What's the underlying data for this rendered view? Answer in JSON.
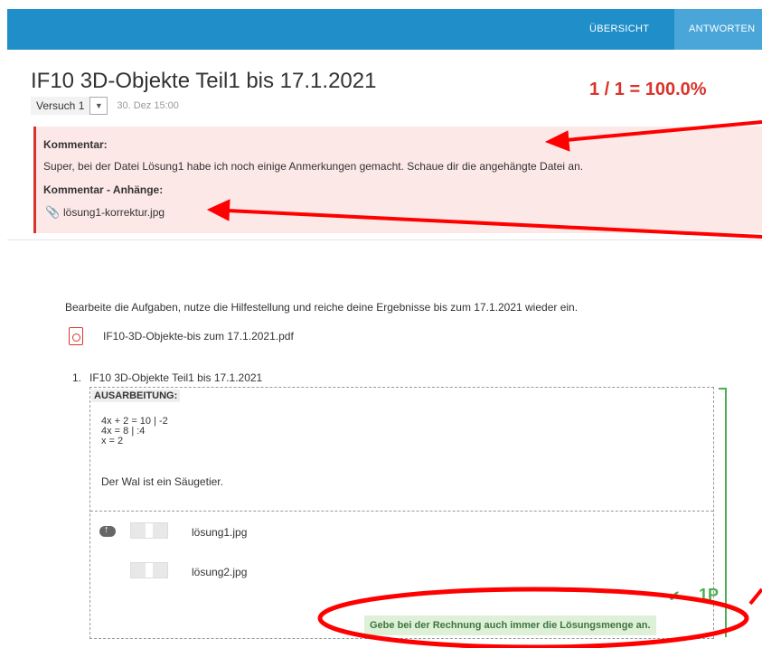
{
  "nav": {
    "overview": "ÜBERSICHT",
    "answers": "ANTWORTEN"
  },
  "header": {
    "title": "IF10 3D-Objekte Teil1 bis 17.1.2021",
    "score": "1 / 1 = 100.0%",
    "attempt": "Versuch 1",
    "attempt_date": "30. Dez 15:00"
  },
  "comment": {
    "heading": "Kommentar:",
    "text": "Super, bei der Datei Lösung1 habe ich noch einige Anmerkungen gemacht. Schaue dir die angehängte Datei an.",
    "attachments_heading": "Kommentar - Anhänge:",
    "attachment": "lösung1-korrektur.jpg"
  },
  "task": {
    "intro": "Bearbeite die Aufgaben, nutze die Hilfestellung und reiche deine Ergebnisse bis zum 17.1.2021 wieder ein.",
    "pdf": "IF10-3D-Objekte-bis zum 17.1.2021.pdf",
    "question_number": "1.",
    "question_title": "IF10 3D-Objekte Teil1 bis 17.1.2021",
    "answer_label": "AUSARBEITUNG:",
    "math_lines": [
      "4x + 2 = 10 | -2",
      "4x = 8 | :4",
      "x = 2"
    ],
    "statement": "Der Wal ist ein Säugetier.",
    "files": [
      "lösung1.jpg",
      "lösung2.jpg"
    ],
    "points": "1P",
    "feedback": "Gebe bei der Rechnung auch immer die Lösungsmenge an."
  },
  "colors": {
    "topbar": "#1f8ec9",
    "score": "#d9342b",
    "annotation": "#ff0000",
    "success": "#4caf50"
  }
}
